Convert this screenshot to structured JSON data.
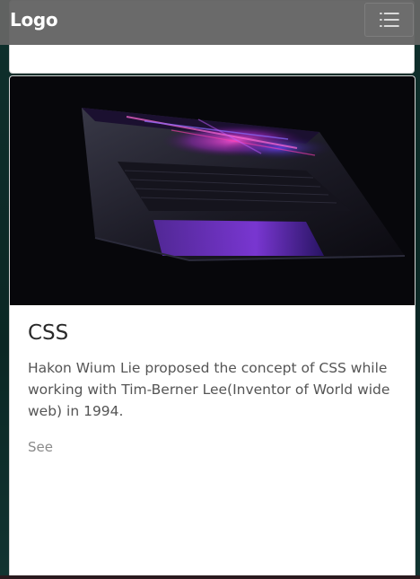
{
  "navbar": {
    "logo_text": "Logo",
    "menu_icon": "hamburger-menu-icon"
  },
  "card": {
    "image_alt": "Laptop in the dark with a colorful glowing screen",
    "title": "CSS",
    "text": "Hakon Wium Lie proposed the concept of CSS while working with Tim-Berner Lee(Inventor of World wide web) in 1994.",
    "link_label": "See"
  },
  "colors": {
    "navbar_bg": "#646464",
    "page_bg": "#0d2a27",
    "card_bg": "#ffffff",
    "title_color": "#2a2a2a",
    "text_color": "#555555",
    "link_color": "#8a8a8a"
  }
}
